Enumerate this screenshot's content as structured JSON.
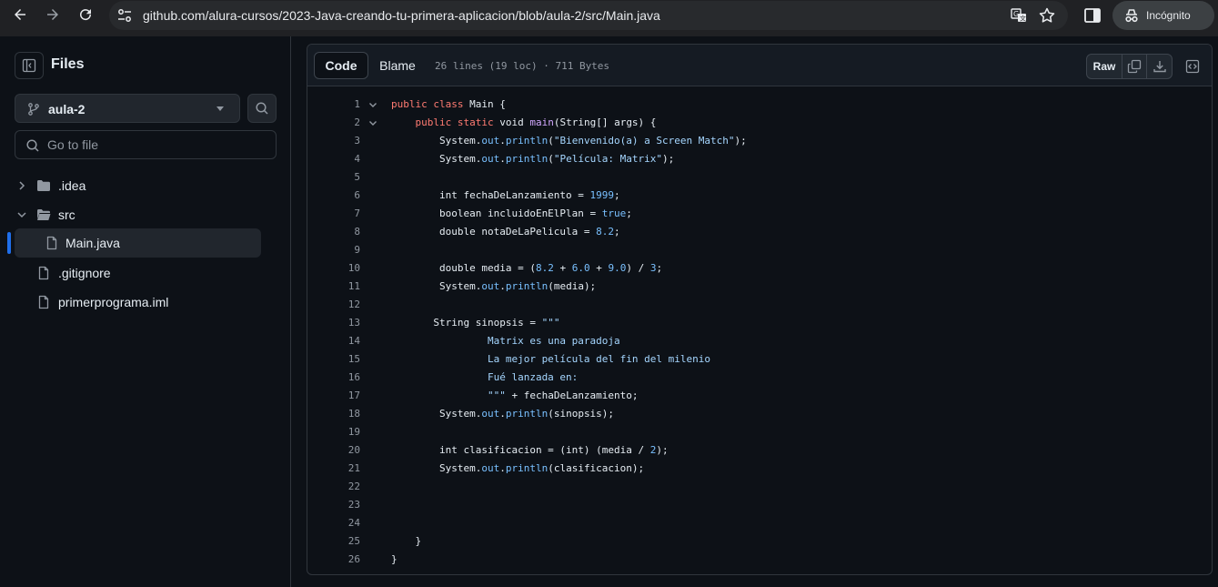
{
  "browser": {
    "url_host": "github.com",
    "url_path": "/alura-cursos/2023-Java-creando-tu-primera-aplicacion/blob/aula-2/src/Main.java",
    "incognito_label": "Incógnito"
  },
  "sidebar": {
    "title": "Files",
    "branch": "aula-2",
    "goto_placeholder": "Go to file",
    "tree": [
      {
        "label": ".idea",
        "type": "folder",
        "expanded": false
      },
      {
        "label": "src",
        "type": "folder",
        "expanded": true
      },
      {
        "label": "Main.java",
        "type": "file",
        "active": true
      },
      {
        "label": ".gitignore",
        "type": "file"
      },
      {
        "label": "primerprograma.iml",
        "type": "file"
      }
    ]
  },
  "code_header": {
    "tab_code": "Code",
    "tab_blame": "Blame",
    "meta": "26 lines (19 loc) · 711 Bytes",
    "raw_label": "Raw"
  },
  "code": {
    "line_numbers": [
      "1",
      "2",
      "3",
      "4",
      "5",
      "6",
      "7",
      "8",
      "9",
      "10",
      "11",
      "12",
      "13",
      "14",
      "15",
      "16",
      "17",
      "18",
      "19",
      "20",
      "21",
      "22",
      "23",
      "24",
      "25",
      "26"
    ],
    "lines": [
      [
        {
          "t": "kw",
          "v": "public class "
        },
        {
          "t": "pl",
          "v": "Main {"
        }
      ],
      [
        {
          "t": "pl",
          "v": "    "
        },
        {
          "t": "kw",
          "v": "public static "
        },
        {
          "t": "pl",
          "v": "void "
        },
        {
          "t": "fn",
          "v": "main"
        },
        {
          "t": "pl",
          "v": "(String[] args) {"
        }
      ],
      [
        {
          "t": "pl",
          "v": "        System."
        },
        {
          "t": "prop",
          "v": "out"
        },
        {
          "t": "pl",
          "v": "."
        },
        {
          "t": "prop",
          "v": "println"
        },
        {
          "t": "pl",
          "v": "("
        },
        {
          "t": "str",
          "v": "\"Bienvenido(a) a Screen Match\""
        },
        {
          "t": "pl",
          "v": ");"
        }
      ],
      [
        {
          "t": "pl",
          "v": "        System."
        },
        {
          "t": "prop",
          "v": "out"
        },
        {
          "t": "pl",
          "v": "."
        },
        {
          "t": "prop",
          "v": "println"
        },
        {
          "t": "pl",
          "v": "("
        },
        {
          "t": "str",
          "v": "\"Película: Matrix\""
        },
        {
          "t": "pl",
          "v": ");"
        }
      ],
      [],
      [
        {
          "t": "pl",
          "v": "        int fechaDeLanzamiento = "
        },
        {
          "t": "num",
          "v": "1999"
        },
        {
          "t": "pl",
          "v": ";"
        }
      ],
      [
        {
          "t": "pl",
          "v": "        boolean incluidoEnElPlan = "
        },
        {
          "t": "num",
          "v": "true"
        },
        {
          "t": "pl",
          "v": ";"
        }
      ],
      [
        {
          "t": "pl",
          "v": "        double notaDeLaPelicula = "
        },
        {
          "t": "num",
          "v": "8.2"
        },
        {
          "t": "pl",
          "v": ";"
        }
      ],
      [],
      [
        {
          "t": "pl",
          "v": "        double media = ("
        },
        {
          "t": "num",
          "v": "8.2"
        },
        {
          "t": "pl",
          "v": " + "
        },
        {
          "t": "num",
          "v": "6.0"
        },
        {
          "t": "pl",
          "v": " + "
        },
        {
          "t": "num",
          "v": "9.0"
        },
        {
          "t": "pl",
          "v": ") / "
        },
        {
          "t": "num",
          "v": "3"
        },
        {
          "t": "pl",
          "v": ";"
        }
      ],
      [
        {
          "t": "pl",
          "v": "        System."
        },
        {
          "t": "prop",
          "v": "out"
        },
        {
          "t": "pl",
          "v": "."
        },
        {
          "t": "prop",
          "v": "println"
        },
        {
          "t": "pl",
          "v": "(media);"
        }
      ],
      [],
      [
        {
          "t": "pl",
          "v": "       String sinopsis = "
        },
        {
          "t": "str",
          "v": "\"\"\""
        }
      ],
      [
        {
          "t": "str",
          "v": "                Matrix es una paradoja"
        }
      ],
      [
        {
          "t": "str",
          "v": "                La mejor película del fin del milenio"
        }
      ],
      [
        {
          "t": "str",
          "v": "                Fué lanzada en:"
        }
      ],
      [
        {
          "t": "str",
          "v": "                \"\"\""
        },
        {
          "t": "pl",
          "v": " + fechaDeLanzamiento;"
        }
      ],
      [
        {
          "t": "pl",
          "v": "        System."
        },
        {
          "t": "prop",
          "v": "out"
        },
        {
          "t": "pl",
          "v": "."
        },
        {
          "t": "prop",
          "v": "println"
        },
        {
          "t": "pl",
          "v": "(sinopsis);"
        }
      ],
      [],
      [
        {
          "t": "pl",
          "v": "        int clasificacion = (int) (media / "
        },
        {
          "t": "num",
          "v": "2"
        },
        {
          "t": "pl",
          "v": ");"
        }
      ],
      [
        {
          "t": "pl",
          "v": "        System."
        },
        {
          "t": "prop",
          "v": "out"
        },
        {
          "t": "pl",
          "v": "."
        },
        {
          "t": "prop",
          "v": "println"
        },
        {
          "t": "pl",
          "v": "(clasificacion);"
        }
      ],
      [],
      [],
      [],
      [
        {
          "t": "pl",
          "v": "    }"
        }
      ],
      [
        {
          "t": "pl",
          "v": "}"
        }
      ]
    ],
    "foldable": [
      1,
      2
    ]
  },
  "colors": {
    "keyword": "#ff7b72",
    "function": "#d2a8ff",
    "string": "#a5d6ff",
    "number": "#79c0ff",
    "accent": "#1f6feb"
  },
  "icons": [
    "back-arrow-icon",
    "forward-arrow-icon",
    "reload-icon",
    "site-settings-icon",
    "translate-icon",
    "star-icon",
    "side-panel-icon",
    "incognito-icon",
    "panel-toggle-icon",
    "branch-icon",
    "search-icon",
    "chevron-right-icon",
    "chevron-down-icon",
    "folder-icon",
    "file-icon",
    "copy-icon",
    "download-icon",
    "symbols-icon"
  ]
}
